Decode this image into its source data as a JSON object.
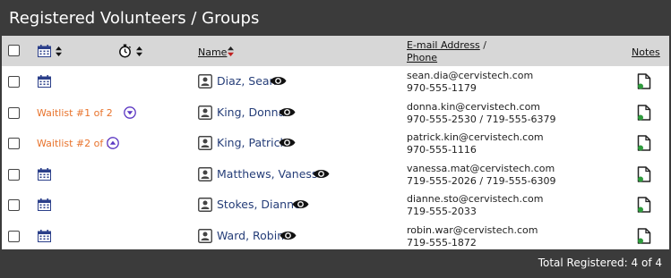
{
  "title": "Registered Volunteers / Groups",
  "header": {
    "name": "Name",
    "email_label": "E-mail Address",
    "email_sep": " /",
    "phone_label": "Phone",
    "notes": "Notes"
  },
  "rows": [
    {
      "waitlist": "",
      "name": "Diaz, Sean",
      "email": "sean.dia@cervistech.com",
      "phone": "970-555-1179"
    },
    {
      "waitlist": "Waitlist #1 of 2",
      "name": "King, Donna",
      "email": "donna.kin@cervistech.com",
      "phone": "970-555-2530 / 719-555-6379"
    },
    {
      "waitlist": "Waitlist #2 of 2",
      "name": "King, Patrick",
      "email": "patrick.kin@cervistech.com",
      "phone": "970-555-1116"
    },
    {
      "waitlist": "",
      "name": "Matthews, Vanessa",
      "email": "vanessa.mat@cervistech.com",
      "phone": "719-555-2026 / 719-555-6309"
    },
    {
      "waitlist": "",
      "name": "Stokes, Dianne",
      "email": "dianne.sto@cervistech.com",
      "phone": "719-555-2033"
    },
    {
      "waitlist": "",
      "name": "Ward, Robin",
      "email": "robin.war@cervistech.com",
      "phone": "719-555-1872"
    }
  ],
  "footer": "Total Registered: 4 of 4",
  "icons": {
    "calendar": "calendar-icon",
    "stopwatch": "stopwatch-icon",
    "sort": "sort-icon",
    "person": "person-icon",
    "eye": "eye-icon",
    "note": "note-icon",
    "move_down": "arrow-down-circle-icon",
    "move_up": "arrow-up-circle-icon"
  },
  "colors": {
    "bar": "#3b3b3b",
    "header_bg": "#d7d7d7",
    "name_link": "#253d78",
    "waitlist": "#e8732c",
    "accent": "#5a36c2",
    "note_dot": "#2e9a3c"
  }
}
